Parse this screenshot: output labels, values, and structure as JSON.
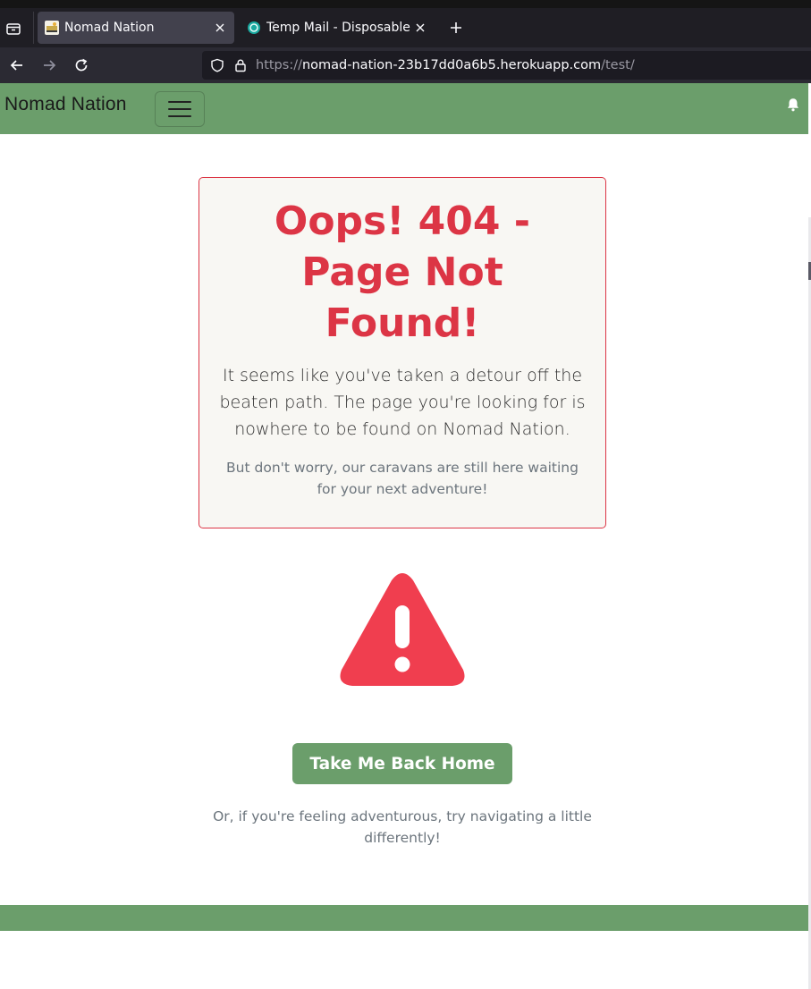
{
  "browser": {
    "tabs": [
      {
        "title": "Nomad Nation",
        "active": true,
        "favicon": "nomad-nation-favicon"
      },
      {
        "title": "Temp Mail - Disposable Te",
        "active": false,
        "favicon": "temp-mail-favicon"
      }
    ],
    "url": {
      "scheme": "https://",
      "host": "nomad-nation-23b17dd0a6b5.herokuapp.com",
      "path": "/test/"
    },
    "icons": [
      "tab-list-icon",
      "close-tab-icon",
      "new-tab-icon",
      "back-icon",
      "forward-icon",
      "reload-icon",
      "shield-icon",
      "lock-icon"
    ]
  },
  "site_nav": {
    "brand": "Nomad Nation",
    "toggler_icon": "hamburger-icon",
    "notification_icon": "bell-icon"
  },
  "error": {
    "title": "Oops! 404 - Page Not Found!",
    "lead": "It seems like you've taken a detour off the beaten path. The page you're looking for is nowhere to be found on Nomad Nation.",
    "sub": "But don't worry, our caravans are still here waiting for your next adventure!",
    "icon": "warning-triangle-icon"
  },
  "actions": {
    "home_button": "Take Me Back Home",
    "alt_text": "Or, if you're feeling adventurous, try navigating a little differently!"
  },
  "colors": {
    "brand_green": "#6b9e6b",
    "danger": "#dc3545",
    "warning_icon": "#f03e4f",
    "muted_text": "#6c757d",
    "card_bg": "#f8f7f3"
  }
}
